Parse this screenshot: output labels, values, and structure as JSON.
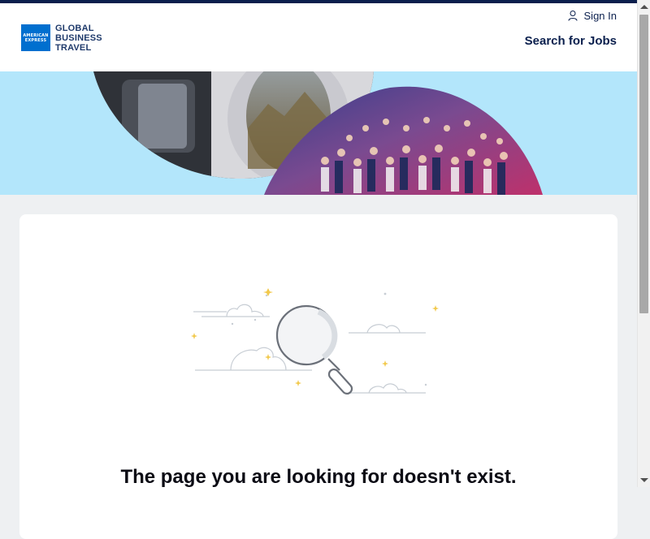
{
  "header": {
    "logo": {
      "badge_text": "AMERICAN EXPRESS",
      "lines": [
        "GLOBAL",
        "BUSINESS",
        "TRAVEL"
      ]
    },
    "sign_in_label": "Sign In",
    "sign_in_icon": "user-icon",
    "search_jobs_label": "Search for Jobs"
  },
  "error": {
    "title": "The page you are looking for doesn't exist.",
    "illustration_icon": "magnifying-glass-icon"
  },
  "colors": {
    "navy": "#0a1f4d",
    "banner_bg": "#b3e6fb",
    "page_bg": "#eef0f2",
    "sparkle": "#f2c94c",
    "brand_blue": "#006fcf"
  }
}
